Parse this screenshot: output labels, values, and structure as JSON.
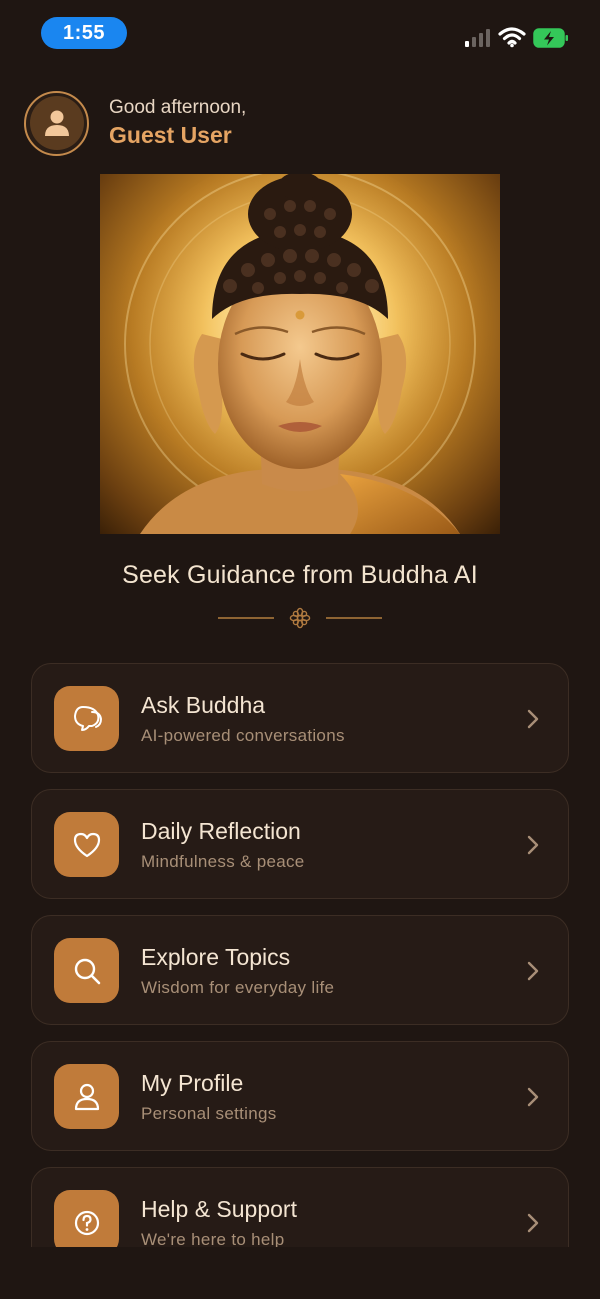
{
  "status_bar": {
    "time": "1:55",
    "icons": [
      "signal-icon",
      "wifi-icon",
      "battery-charging-icon"
    ]
  },
  "header": {
    "greeting": "Good afternoon,",
    "user_name": "Guest User"
  },
  "hero": {
    "image": "buddha-portrait"
  },
  "main": {
    "title": "Seek Guidance from Buddha AI"
  },
  "menu": {
    "items": [
      {
        "title": "Ask Buddha",
        "subtitle": "AI-powered conversations",
        "icon": "chat-bubbles-icon"
      },
      {
        "title": "Daily Reflection",
        "subtitle": "Mindfulness & peace",
        "icon": "heart-icon"
      },
      {
        "title": "Explore Topics",
        "subtitle": "Wisdom for everyday life",
        "icon": "search-icon"
      },
      {
        "title": "My Profile",
        "subtitle": "Personal settings",
        "icon": "user-icon"
      },
      {
        "title": "Help & Support",
        "subtitle": "We're here to help",
        "icon": "help-circle-icon"
      }
    ]
  },
  "colors": {
    "background": "#1f1612",
    "accent": "#c07b3a",
    "accent_text": "#e5a463",
    "card": "#261b16",
    "time_pill": "#1a86f0",
    "battery": "#34c759"
  }
}
